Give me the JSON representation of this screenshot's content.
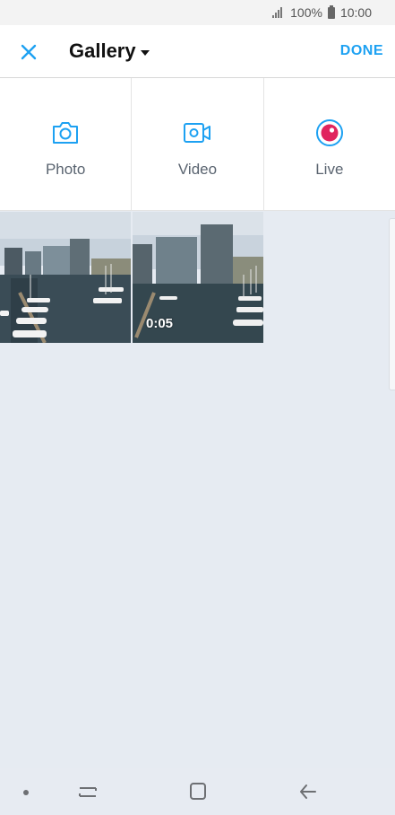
{
  "status_bar": {
    "battery": "100%",
    "time": "10:00"
  },
  "app_bar": {
    "title": "Gallery",
    "done_label": "DONE"
  },
  "media_options": [
    {
      "label": "Photo",
      "icon": "camera-icon"
    },
    {
      "label": "Video",
      "icon": "video-camera-icon"
    },
    {
      "label": "Live",
      "icon": "live-broadcast-icon"
    }
  ],
  "gallery": {
    "items": [
      {
        "type": "photo"
      },
      {
        "type": "video",
        "duration": "0:05"
      }
    ]
  },
  "colors": {
    "accent": "#1da1f2",
    "live": "#e0245e",
    "background": "#e6ebf2"
  },
  "nav_bar": {
    "buttons": [
      "recent-apps-icon",
      "home-icon",
      "back-icon"
    ]
  }
}
